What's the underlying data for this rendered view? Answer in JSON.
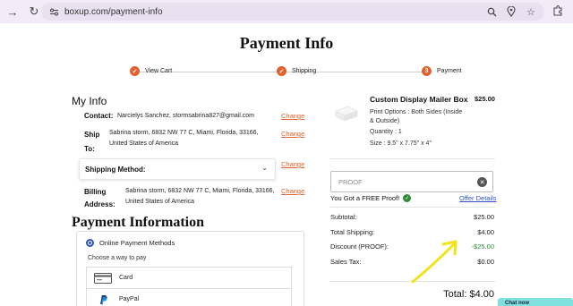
{
  "browser": {
    "url": "boxup.com/payment-info",
    "forward_icon": "arrow-forward-icon",
    "reload_icon": "reload-icon"
  },
  "page": {
    "title": "Payment Info"
  },
  "steps": [
    {
      "label": "View Cart",
      "marker": "✓"
    },
    {
      "label": "Shipping",
      "marker": "✓"
    },
    {
      "label": "Payment",
      "marker": "3"
    }
  ],
  "my_info": {
    "title": "My Info",
    "change_label": "Change",
    "contact": {
      "label": "Contact:",
      "value": "Narcielys Sanchez, stormsabrina827@gmail.com"
    },
    "ship_to": {
      "label_line1": "Ship",
      "label_line2": "To:",
      "line1": "Sabrina storm, 6832 NW 77 C, Miami, Florida, 33166,",
      "line2": "United States of America"
    },
    "shipping_method": {
      "label": "Shipping Method:"
    },
    "billing": {
      "label_line1": "Billing",
      "label_line2": "Address:",
      "line1": "Sabrina storm, 6832 NW 77 C, Miami, Florida, 33166,",
      "line2": "United States of America"
    }
  },
  "payment": {
    "title": "Payment Information",
    "online_label": "Online Payment Methods",
    "choose_text": "Choose a way to pay",
    "methods": [
      {
        "label": "Card",
        "icon": "card-icon"
      },
      {
        "label": "PayPal",
        "icon": "paypal-icon"
      }
    ]
  },
  "order": {
    "product_title": "Custom Display Mailer Box",
    "product_price": "$25.00",
    "print_options_1": "Print Options : Both Sides (Inside",
    "print_options_2": "& Outside)",
    "quantity": "Quantity : 1",
    "size": "Size : 9.5\" x 7.75\" x 4\"",
    "promo_placeholder": "PROOF",
    "free_proof": "You Got a FREE Proof!",
    "offer_details": "Offer Details",
    "subtotal_label": "Subtotal:",
    "subtotal_value": "$25.00",
    "shipping_label": "Total Shipping:",
    "shipping_value": "$4.00",
    "discount_label": "Discount (PROOF):",
    "discount_value": "-$25.00",
    "tax_label": "Sales Tax:",
    "tax_value": "$0.00",
    "total_label": "Total:",
    "total_value": "$4.00"
  },
  "chat": {
    "label": "Chat now"
  },
  "colors": {
    "accent": "#e0632f",
    "link": "#2f52c6",
    "success": "#2e8b3c",
    "annotation": "#f2e21a"
  }
}
